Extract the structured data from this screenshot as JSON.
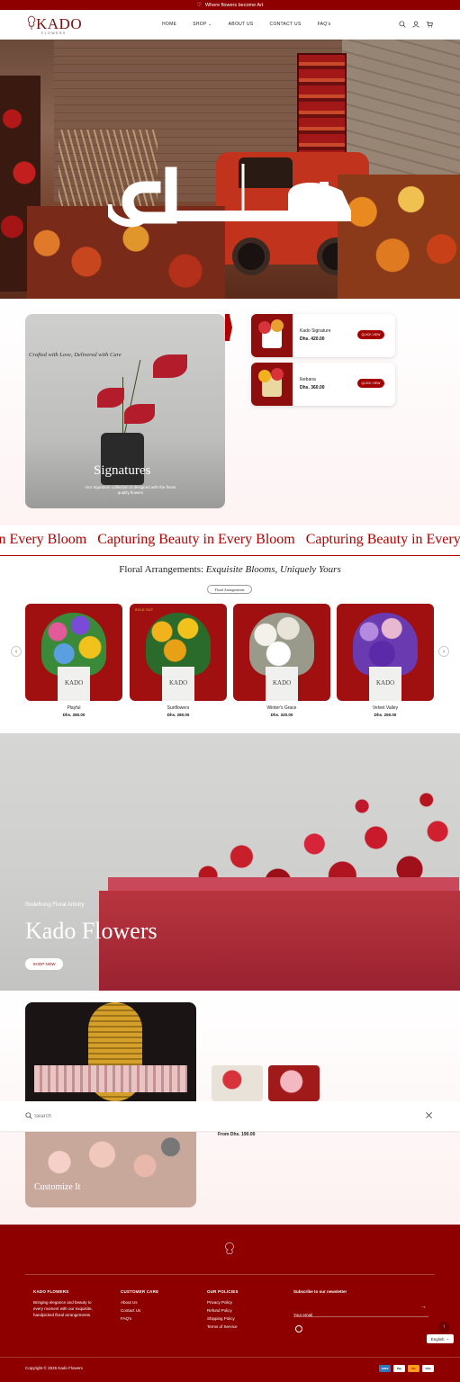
{
  "announcement": {
    "text": "Where flowers become Art",
    "icon": "heart-icon"
  },
  "brand": {
    "logo_text": "KADO",
    "logo_sub": "FLOWERS"
  },
  "nav": [
    {
      "label": "HOME"
    },
    {
      "label": "SHOP"
    },
    {
      "label": "ABOUT US"
    },
    {
      "label": "CONTACT US"
    },
    {
      "label": "FAQ's"
    }
  ],
  "header_icons": [
    "search-icon",
    "account-icon",
    "cart-icon"
  ],
  "signatures": {
    "tagline": "Crafted with Love, Delivered with Care",
    "title": "Signatures",
    "description": "Our Signature collection is designed with the finest quality flowers",
    "products": [
      {
        "name": "Kado Signature",
        "price": "Dhs. 420.00",
        "button": "QUICK VIEW"
      },
      {
        "name": "Ikebana",
        "price": "Dhs. 360.00",
        "button": "QUICK VIEW"
      }
    ]
  },
  "marquee": {
    "items": [
      "y in Every Bloom",
      "Capturing Beauty in Every Bloom",
      "Capturing Beauty in Every"
    ]
  },
  "floral": {
    "heading_main": "Floral Arrangements:",
    "heading_italic": "Exquisite Blooms, Uniquely Yours",
    "pill": "Floral Arrangements",
    "products": [
      {
        "name": "Playful",
        "price": "Dhs. 280.00",
        "badge": ""
      },
      {
        "name": "Sunflowers",
        "price": "Dhs. 280.00",
        "badge": "SOLD OUT"
      },
      {
        "name": "Winter's Grace",
        "price": "Dhs. 320.00",
        "badge": ""
      },
      {
        "name": "Velvet Valley",
        "price": "Dhs. 250.00",
        "badge": ""
      }
    ]
  },
  "banner": {
    "kicker": "Redefining Floral Artistry",
    "title": "Kado Flowers",
    "button": "SHOP NOW"
  },
  "customize": {
    "title": "Customize It",
    "from_price": "From Dhs. 190.00"
  },
  "search": {
    "placeholder": "Search"
  },
  "footer": {
    "col1": {
      "title": "KADO FLOWERS",
      "text": "Bringing elegance and beauty to every moment with our exquisite, handpicked floral arrangements."
    },
    "col2": {
      "title": "CUSTOMER CARE",
      "links": [
        "About Us",
        "Contact Us",
        "FAQ's"
      ]
    },
    "col3": {
      "title": "OUR POLICIES",
      "links": [
        "Privacy Policy",
        "Refund Policy",
        "Shipping Policy",
        "Terms of Service"
      ]
    },
    "newsletter": {
      "title": "Subscribe to our newsletter",
      "placeholder": "Your email"
    },
    "language": "English",
    "copyright": "Copyright © 2025 Kado Flowers",
    "payments": [
      "AMEX",
      "Pay",
      "MC",
      "VISA"
    ]
  },
  "colors": {
    "brand": "#8e0000",
    "accent": "#b00000"
  }
}
